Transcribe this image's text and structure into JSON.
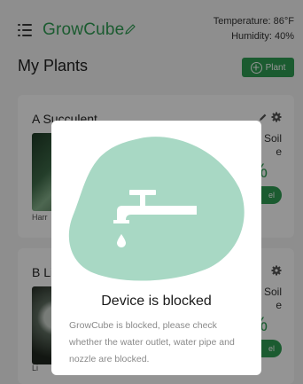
{
  "app": {
    "brand": "GrowCube",
    "temperature": "Temperature: 86°F",
    "humidity": "Humidity: 40%"
  },
  "section": {
    "title": "My Plants",
    "add_label": "Plant"
  },
  "cards": [
    {
      "name": "A Succulent",
      "soil_line1": "Soil",
      "soil_line2": "e",
      "percent": "%",
      "owner": "Harr",
      "pill_label": "el"
    },
    {
      "name": "B Li",
      "soil_line1": "Soil",
      "soil_line2": "e",
      "percent": "%",
      "owner": "Li",
      "pill_label": "el"
    }
  ],
  "modal": {
    "title": "Device is blocked",
    "body": "GrowCube is blocked, please check whether the water outlet, water pipe and nozzle are blocked."
  },
  "colors": {
    "brand_green": "#2f9e54",
    "blob_mint": "#a8d8c4",
    "overlay": "rgba(0,0,0,0.42)"
  },
  "icons": [
    "menu-icon",
    "pencil-icon",
    "plus-circle-icon",
    "gear-icon",
    "water-tap-icon"
  ]
}
